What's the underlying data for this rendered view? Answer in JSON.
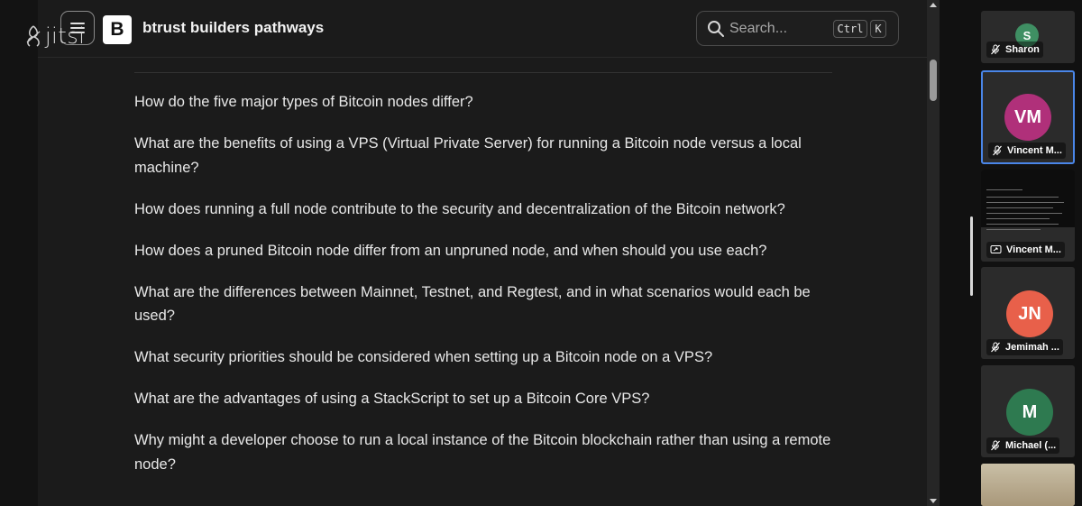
{
  "watermark": {
    "text": "jitsi"
  },
  "header": {
    "logo_letter": "B",
    "site_title": "btrust builders pathways",
    "search": {
      "placeholder": "Search...",
      "shortcut_ctrl": "Ctrl",
      "shortcut_key": "K"
    }
  },
  "questions": [
    "How do the five major types of Bitcoin nodes differ?",
    "What are the benefits of using a VPS (Virtual Private Server) for running a Bitcoin node versus a local machine?",
    "How does running a full node contribute to the security and decentralization of the Bitcoin network?",
    "How does a pruned Bitcoin node differ from an unpruned node, and when should you use each?",
    "What are the differences between Mainnet, Testnet, and Regtest, and in what scenarios would each be used?",
    "What security priorities should be considered when setting up a Bitcoin node on a VPS?",
    "What are the advantages of using a StackScript to set up a Bitcoin Core VPS?",
    "Why might a developer choose to run a local instance of the Bitcoin blockchain rather than using a remote node?"
  ],
  "participants": [
    {
      "initials": "S",
      "name": "Sharon",
      "color": "#3f8f63",
      "icon": "mic-muted-icon"
    },
    {
      "initials": "VM",
      "name": "Vincent M...",
      "color": "#b0307a",
      "icon": "mic-muted-icon"
    },
    {
      "initials": "",
      "name": "Vincent M...",
      "color": "#0d0d0d",
      "icon": "screen-share-icon"
    },
    {
      "initials": "JN",
      "name": "Jemimah ...",
      "color": "#e8604a",
      "icon": "mic-muted-icon"
    },
    {
      "initials": "M",
      "name": "Michael (...",
      "color": "#2e7a50",
      "icon": "mic-muted-icon"
    }
  ],
  "colors": {
    "active_border": "#4a86e8",
    "background": "#1b1b1b"
  }
}
